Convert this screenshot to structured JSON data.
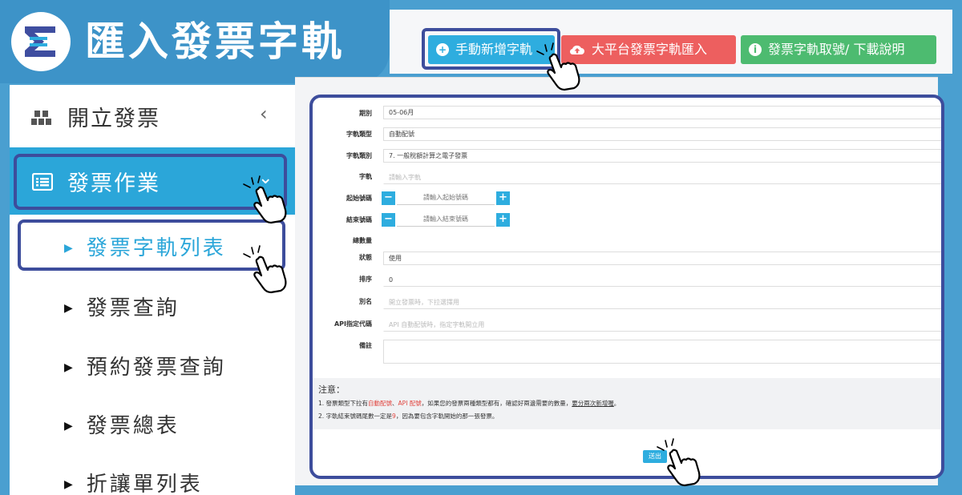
{
  "banner": {
    "title": "匯入發票字軌"
  },
  "toolbar": {
    "manual_add": "手動新增字軌",
    "platform_import": "大平台發票字軌匯入",
    "download_info": "發票字軌取號/ 下載說明"
  },
  "sidebar": {
    "header": "開立發票",
    "collapse_glyph": "‹",
    "section": "發票作業",
    "items": [
      {
        "label": "發票字軌列表"
      },
      {
        "label": "發票查詢"
      },
      {
        "label": "預約發票查詢"
      },
      {
        "label": "發票總表"
      },
      {
        "label": "折讓單列表"
      }
    ]
  },
  "form": {
    "period": {
      "label": "期別",
      "value": "05-06月"
    },
    "track_type": {
      "label": "字軌類型",
      "value": "自動配號"
    },
    "track_category": {
      "label": "字軌類別",
      "value": "7. 一般稅額計算之電子發票"
    },
    "track": {
      "label": "字軌",
      "placeholder": "請輸入字軌"
    },
    "start_no": {
      "label": "起始號碼",
      "placeholder": "請輸入起始號碼"
    },
    "end_no": {
      "label": "結束號碼",
      "placeholder": "請輸入結束號碼"
    },
    "total": {
      "label": "總數量"
    },
    "status": {
      "label": "狀態",
      "value": "使用"
    },
    "order": {
      "label": "排序",
      "value": "0"
    },
    "alias": {
      "label": "別名",
      "placeholder": "開立發票時，下拉選擇用"
    },
    "api_code": {
      "label": "API指定代碼",
      "placeholder": "API 自動配號時，指定字軌開立用"
    },
    "remark": {
      "label": "備註"
    }
  },
  "note": {
    "title": "注意：",
    "line1_a": "1. 發票類型下拉有",
    "line1_red1": "自動配號",
    "line1_b": "、",
    "line1_red2": "API 配號",
    "line1_c": "，如果您的發票兩種類型都有，確認好兩邊需要的數量，",
    "line1_ul": "要分兩次新增喔",
    "line1_d": "。",
    "line2_a": "2. 字軌結束號碼尾數一定是",
    "line2_red": "9",
    "line2_b": "，因為要包含字軌開始的那一張發票。"
  },
  "submit_label": "送出",
  "colors": {
    "primary": "#2eaddf",
    "danger": "#ed5f5f",
    "success": "#4dbb70",
    "highlight": "#3d4d9c"
  }
}
